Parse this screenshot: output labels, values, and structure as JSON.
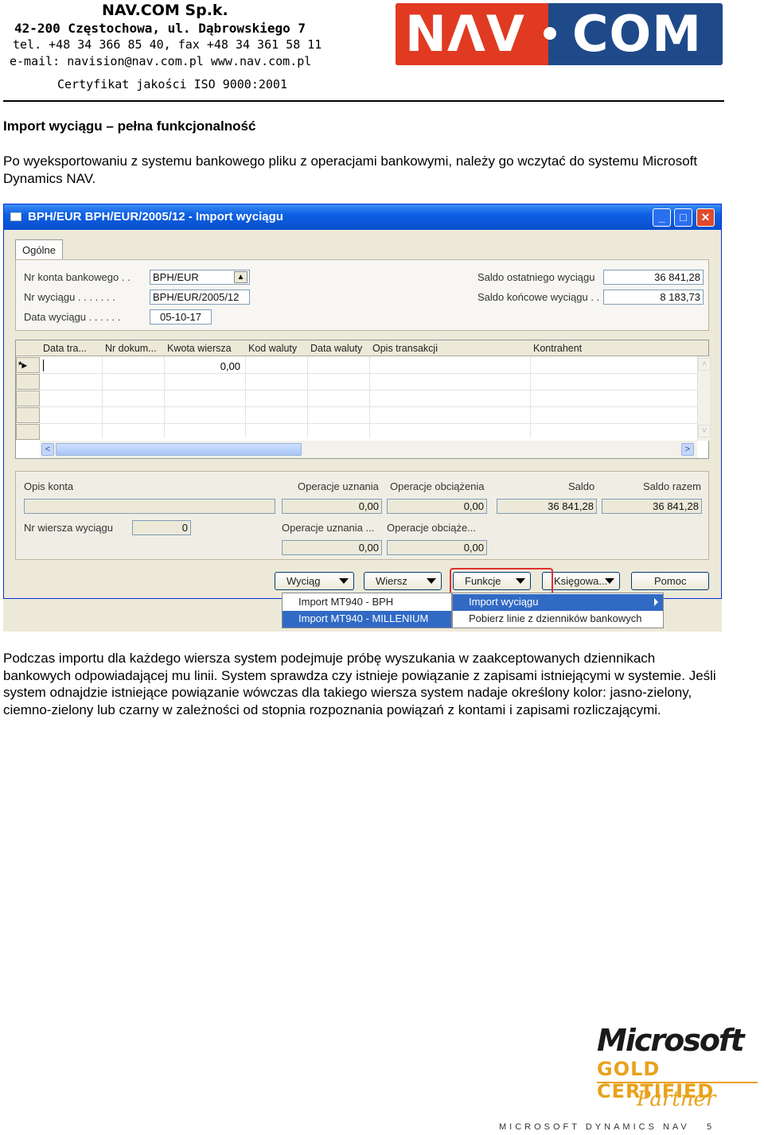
{
  "letterhead": {
    "company": "NAV.COM Sp.k.",
    "address": "42-200 Częstochowa, ul. Dąbrowskiego 7",
    "phone": "tel. +48 34 366 85 40, fax +48 34 361 58 11",
    "email_web": "e-mail: navision@nav.com.pl   www.nav.com.pl",
    "certificate": "Certyfikat jakości ISO 9000:2001",
    "logo": "NAV COM"
  },
  "section_title": "Import wyciągu – pełna funkcjonalność",
  "intro": "Po wyeksportowaniu z systemu bankowego pliku z operacjami bankowymi, należy go wczytać do systemu Microsoft Dynamics NAV.",
  "window": {
    "title": "BPH/EUR BPH/EUR/2005/12 - Import wyciągu",
    "tab": "Ogólne",
    "general": {
      "bank_account_label": "Nr konta bankowego . .",
      "bank_account_value": "BPH/EUR",
      "statement_no_label": "Nr wyciągu . . . . . . .",
      "statement_no_value": "BPH/EUR/2005/12",
      "statement_date_label": "Data wyciągu . . . . . .",
      "statement_date_value": "05-10-17",
      "last_balance_label": "Saldo ostatniego wyciągu",
      "last_balance_value": "36 841,28",
      "ending_balance_label": "Saldo końcowe wyciągu . .",
      "ending_balance_value": "8 183,73"
    },
    "grid": {
      "columns": [
        "Data tra...",
        "Nr dokum...",
        "Kwota wiersza",
        "Kod waluty",
        "Data waluty",
        "Opis transakcji",
        "Kontrahent"
      ],
      "new_row_marker": "*▸",
      "first_amount": "0,00"
    },
    "summary": {
      "account_desc_label": "Opis konta",
      "credit_ops_label": "Operacje uznania",
      "debit_ops_label": "Operacje obciążenia",
      "balance_label": "Saldo",
      "total_balance_label": "Saldo razem",
      "credit_ops_value": "0,00",
      "debit_ops_value": "0,00",
      "balance_value": "36 841,28",
      "total_balance_value": "36 841,28",
      "line_no_label": "Nr wiersza wyciągu",
      "line_no_value": "0",
      "credit_ops2_label": "Operacje uznania ...",
      "debit_ops2_label": "Operacje obciąże...",
      "credit_ops2_value": "0,00",
      "debit_ops2_value": "0,00"
    },
    "buttons": {
      "statement": "Wyciąg",
      "line": "Wiersz",
      "functions": "Funkcje",
      "posting": "Księgowa...",
      "help": "Pomoc"
    },
    "left_menu": [
      "Import MT940 - BPH",
      "Import MT940  - MILLENIUM"
    ],
    "functions_menu": [
      "Import wyciągu",
      "Pobierz linie z dzienników bankowych"
    ]
  },
  "body_paragraph": "Podczas importu dla każdego wiersza system podejmuje próbę wyszukania w zaakceptowanych dziennikach bankowych odpowiadającej mu linii. System sprawdza czy istnieje powiązanie z zapisami istniejącymi w systemie. Jeśli system odnajdzie istniejące powiązanie wówczas dla takiego wiersza system nadaje określony kolor: jasno-zielony, ciemno-zielony lub czarny w zależności od stopnia rozpoznania powiązań z kontami i zapisami rozliczającymi.",
  "badge": {
    "line1": "Microsoft",
    "line2": "GOLD CERTIFIED",
    "line3": "Partner"
  },
  "footer": {
    "text": "MICROSOFT DYNAMICS NAV",
    "page": "5"
  }
}
